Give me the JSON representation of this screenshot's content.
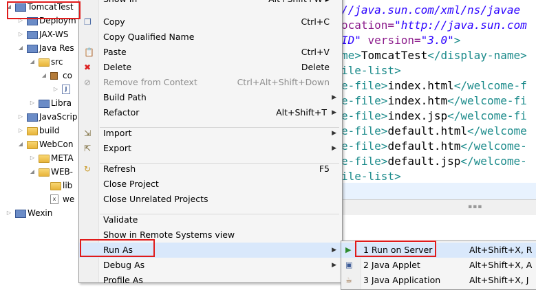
{
  "explorer": {
    "items": [
      {
        "label": "TomcatTest",
        "twisty": "◢",
        "icon": "project-icon"
      },
      {
        "label": "Deploym",
        "twisty": "▷",
        "icon": "deployment-icon"
      },
      {
        "label": "JAX-WS",
        "twisty": "▷",
        "icon": "jaxws-icon"
      },
      {
        "label": "Java Res",
        "twisty": "◢",
        "icon": "java-resources-icon"
      },
      {
        "label": "src",
        "twisty": "◢",
        "icon": "source-folder-icon"
      },
      {
        "label": "co",
        "twisty": "◢",
        "icon": "package-icon"
      },
      {
        "label": "",
        "twisty": "▷",
        "icon": "java-file-icon"
      },
      {
        "label": "Libra",
        "twisty": "▷",
        "icon": "library-icon"
      },
      {
        "label": "JavaScrip",
        "twisty": "▷",
        "icon": "javascript-icon"
      },
      {
        "label": "build",
        "twisty": "▷",
        "icon": "folder-icon"
      },
      {
        "label": "WebCon",
        "twisty": "◢",
        "icon": "folder-icon"
      },
      {
        "label": "META",
        "twisty": "▷",
        "icon": "folder-icon"
      },
      {
        "label": "WEB-",
        "twisty": "◢",
        "icon": "folder-icon"
      },
      {
        "label": "lib",
        "twisty": "",
        "icon": "folder-icon"
      },
      {
        "label": "we",
        "twisty": "",
        "icon": "xml-file-icon"
      },
      {
        "label": "Wexin",
        "twisty": "▷",
        "icon": "project-icon"
      }
    ]
  },
  "context_menu": {
    "items": [
      {
        "label": "Show In",
        "shortcut": "Alt+Shift+W ▸"
      },
      {
        "label": "Copy",
        "shortcut": "Ctrl+C",
        "icon": "copy-icon"
      },
      {
        "label": "Copy Qualified Name",
        "shortcut": "",
        "icon": ""
      },
      {
        "label": "Paste",
        "shortcut": "Ctrl+V",
        "icon": "paste-icon"
      },
      {
        "label": "Delete",
        "shortcut": "Delete",
        "icon": "delete-icon"
      },
      {
        "label": "Remove from Context",
        "shortcut": "Ctrl+Alt+Shift+Down",
        "icon": "remove-context-icon",
        "disabled": true
      },
      {
        "label": "Build Path",
        "shortcut": "",
        "submenu": true
      },
      {
        "label": "Refactor",
        "shortcut": "Alt+Shift+T",
        "submenu": true
      },
      {
        "label": "Import",
        "shortcut": "",
        "submenu": true,
        "icon": "import-icon"
      },
      {
        "label": "Export",
        "shortcut": "",
        "submenu": true,
        "icon": "export-icon"
      },
      {
        "label": "Refresh",
        "shortcut": "F5",
        "icon": "refresh-icon"
      },
      {
        "label": "Close Project",
        "shortcut": ""
      },
      {
        "label": "Close Unrelated Projects",
        "shortcut": ""
      },
      {
        "label": "Validate",
        "shortcut": ""
      },
      {
        "label": "Show in Remote Systems view",
        "shortcut": ""
      },
      {
        "label": "Run As",
        "shortcut": "",
        "submenu": true
      },
      {
        "label": "Debug As",
        "shortcut": "",
        "submenu": true
      },
      {
        "label": "Profile As",
        "shortcut": ""
      }
    ]
  },
  "run_as_submenu": {
    "items": [
      {
        "label": "1 Run on Server",
        "shortcut": "Alt+Shift+X, R",
        "icon": "run-on-server-icon"
      },
      {
        "label": "2 Java Applet",
        "shortcut": "Alt+Shift+X, A",
        "icon": "java-applet-icon"
      },
      {
        "label": "3 Java Application",
        "shortcut": "Alt+Shift+X, J",
        "icon": "java-app-icon"
      }
    ]
  },
  "editor": {
    "lines": [
      {
        "parts": [
          {
            "c": "val",
            "t": "//java.sun.com/xml/ns/javae"
          }
        ]
      },
      {
        "parts": [
          {
            "c": "attr",
            "t": "ocation="
          },
          {
            "c": "val",
            "t": "\"http://java.sun.com"
          }
        ]
      },
      {
        "parts": [
          {
            "c": "val",
            "t": "ID\""
          },
          {
            "c": "attr",
            "t": " version="
          },
          {
            "c": "val",
            "t": "\"3.0\""
          },
          {
            "c": "tag",
            "t": ">"
          }
        ]
      },
      {
        "parts": [
          {
            "c": "tag",
            "t": "me>"
          },
          {
            "c": "txt",
            "t": "TomcatTest"
          },
          {
            "c": "tag",
            "t": "</display-name>"
          }
        ]
      },
      {
        "parts": [
          {
            "c": "tag",
            "t": "ile-list>"
          }
        ]
      },
      {
        "parts": [
          {
            "c": "tag",
            "t": "e-file>"
          },
          {
            "c": "txt",
            "t": "index.html"
          },
          {
            "c": "tag",
            "t": "</welcome-f"
          }
        ]
      },
      {
        "parts": [
          {
            "c": "tag",
            "t": "e-file>"
          },
          {
            "c": "txt",
            "t": "index.htm"
          },
          {
            "c": "tag",
            "t": "</welcome-fi"
          }
        ]
      },
      {
        "parts": [
          {
            "c": "tag",
            "t": "e-file>"
          },
          {
            "c": "txt",
            "t": "index.jsp"
          },
          {
            "c": "tag",
            "t": "</welcome-fi"
          }
        ]
      },
      {
        "parts": [
          {
            "c": "tag",
            "t": "e-file>"
          },
          {
            "c": "txt",
            "t": "default.html"
          },
          {
            "c": "tag",
            "t": "</welcome"
          }
        ]
      },
      {
        "parts": [
          {
            "c": "tag",
            "t": "e-file>"
          },
          {
            "c": "txt",
            "t": "default.htm"
          },
          {
            "c": "tag",
            "t": "</welcome-"
          }
        ]
      },
      {
        "parts": [
          {
            "c": "tag",
            "t": "e-file>"
          },
          {
            "c": "txt",
            "t": "default.jsp"
          },
          {
            "c": "tag",
            "t": "</welcome-"
          }
        ]
      },
      {
        "parts": [
          {
            "c": "tag",
            "t": "ile-list>"
          }
        ]
      }
    ]
  }
}
